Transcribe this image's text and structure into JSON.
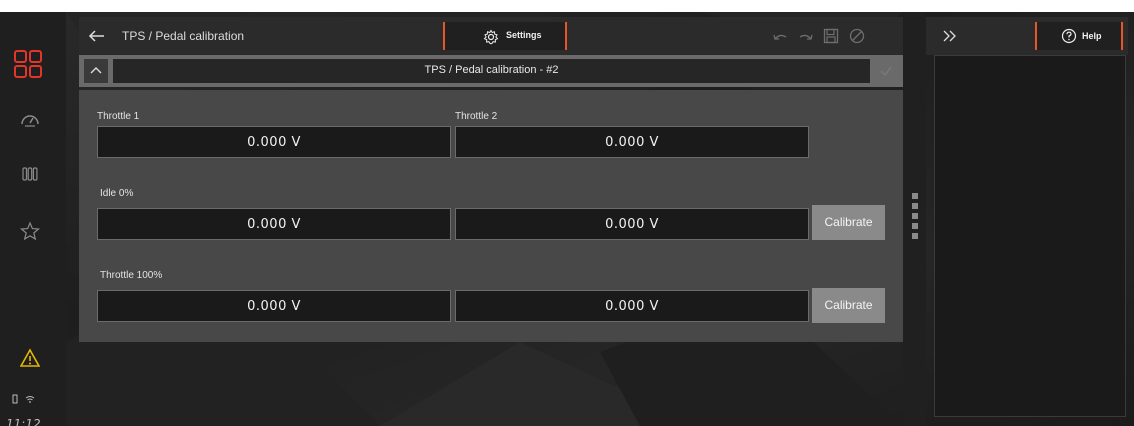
{
  "status": {
    "clock": "11:12"
  },
  "sidebar": {
    "items": [
      {
        "icon": "logo-icon"
      },
      {
        "icon": "gauge-icon"
      },
      {
        "icon": "columns-icon"
      },
      {
        "icon": "star-icon"
      }
    ],
    "warning_icon": "warning-triangle-icon",
    "warning_color": "#e6b800"
  },
  "topbar": {
    "breadcrumb": "TPS / Pedal calibration",
    "settings_label": "Settings",
    "accent_color": "#e5572a"
  },
  "section": {
    "title": "TPS / Pedal calibration - #2"
  },
  "form": {
    "throttle1_label": "Throttle 1",
    "throttle2_label": "Throttle 2",
    "throttle1_value": "0.000 V",
    "throttle2_value": "0.000 V",
    "idle_label": "Idle 0%",
    "idle_value1": "0.000 V",
    "idle_value2": "0.000 V",
    "idle_button": "Calibrate",
    "full_label": "Throttle 100%",
    "full_value1": "0.000 V",
    "full_value2": "0.000 V",
    "full_button": "Calibrate"
  },
  "help_panel": {
    "help_label": "Help"
  }
}
